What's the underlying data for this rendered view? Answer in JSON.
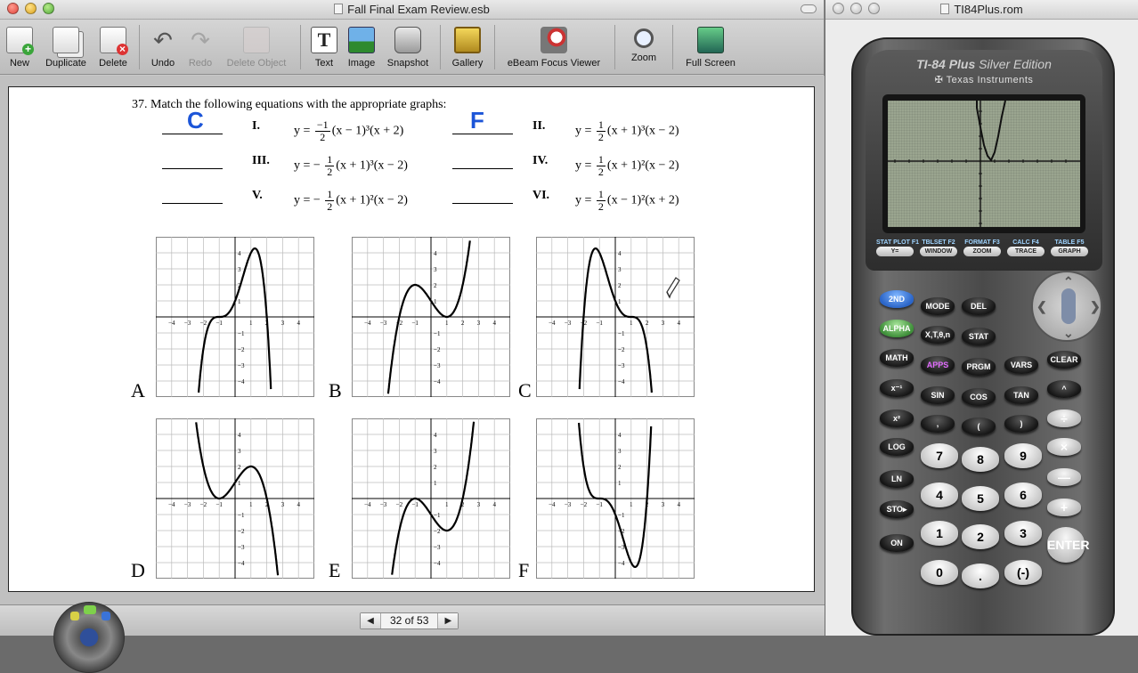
{
  "left_window": {
    "title": "Fall Final Exam Review.esb",
    "toolbar": {
      "new": "New",
      "duplicate": "Duplicate",
      "delete": "Delete",
      "undo": "Undo",
      "redo": "Redo",
      "delete_object": "Delete Object",
      "text": "Text",
      "image": "Image",
      "snapshot": "Snapshot",
      "gallery": "Gallery",
      "ebeam_focus_viewer": "eBeam Focus Viewer",
      "zoom": "Zoom",
      "full_screen": "Full Screen"
    },
    "page": {
      "problem": "37.  Match the following equations with the appropriate graphs:",
      "items": [
        {
          "numeral": "I.",
          "eq_prefix": "y =",
          "num": "−1",
          "den": "2",
          "eq_rest": "(x − 1)³(x + 2)",
          "answer": "C"
        },
        {
          "numeral": "II.",
          "eq_prefix": "y =",
          "num": "1",
          "den": "2",
          "eq_rest": "(x + 1)³(x − 2)",
          "answer": "F"
        },
        {
          "numeral": "III.",
          "eq_prefix": "y = −",
          "num": "1",
          "den": "2",
          "eq_rest": "(x + 1)³(x − 2)",
          "answer": ""
        },
        {
          "numeral": "IV.",
          "eq_prefix": "y =",
          "num": "1",
          "den": "2",
          "eq_rest": "(x + 1)²(x − 2)",
          "answer": ""
        },
        {
          "numeral": "V.",
          "eq_prefix": "y = −",
          "num": "1",
          "den": "2",
          "eq_rest": "(x + 1)²(x − 2)",
          "answer": ""
        },
        {
          "numeral": "VI.",
          "eq_prefix": "y =",
          "num": "1",
          "den": "2",
          "eq_rest": "(x − 1)²(x + 2)",
          "answer": ""
        }
      ],
      "graphs": [
        {
          "label": "A"
        },
        {
          "label": "B"
        },
        {
          "label": "C"
        },
        {
          "label": "D"
        },
        {
          "label": "E"
        },
        {
          "label": "F"
        }
      ],
      "x_tick_labels": [
        "−4",
        "−3",
        "−2",
        "−1",
        "1",
        "2",
        "3",
        "4"
      ],
      "y_tick_labels": [
        "4",
        "3",
        "2",
        "1",
        "−1",
        "−2",
        "−3",
        "−4"
      ]
    },
    "pager": {
      "prev": "◀",
      "count": "32 of 53",
      "next": "▶"
    }
  },
  "right_window": {
    "title": "TI84Plus.rom",
    "brand_model": "TI-84 Plus",
    "brand_edition": "Silver Edition",
    "brand_maker": "Texas Instruments",
    "fkeys": [
      {
        "top": "STAT PLOT",
        "f": "F1",
        "key": "Y="
      },
      {
        "top": "TBLSET",
        "f": "F2",
        "key": "WINDOW"
      },
      {
        "top": "FORMAT",
        "f": "F3",
        "key": "ZOOM"
      },
      {
        "top": "CALC",
        "f": "F4",
        "key": "TRACE"
      },
      {
        "top": "TABLE",
        "f": "F5",
        "key": "GRAPH"
      }
    ],
    "keys": {
      "second": "2ND",
      "mode": "MODE",
      "del": "DEL",
      "alpha": "ALPHA",
      "xt": "X,T,θ,n",
      "stat": "STAT",
      "math": "MATH",
      "apps": "APPS",
      "prgm": "PRGM",
      "vars": "VARS",
      "clear": "CLEAR",
      "xinv": "x⁻¹",
      "sin": "SIN",
      "cos": "COS",
      "tan": "TAN",
      "pow": "^",
      "x2": "x²",
      "comma": ",",
      "lparen": "(",
      "rparen": ")",
      "div": "÷",
      "log": "LOG",
      "k7": "7",
      "k8": "8",
      "k9": "9",
      "mul": "×",
      "ln": "LN",
      "k4": "4",
      "k5": "5",
      "k6": "6",
      "minus": "—",
      "sto": "STO▸",
      "k1": "1",
      "k2": "2",
      "k3": "3",
      "plus": "+",
      "on": "ON",
      "k0": "0",
      "dot": ".",
      "neg": "(-)",
      "enter": "ENTER"
    }
  }
}
